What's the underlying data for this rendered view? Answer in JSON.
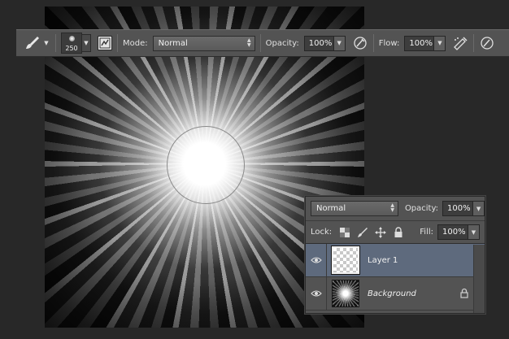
{
  "options_bar": {
    "brush_size": "250",
    "mode_label": "Mode:",
    "mode_value": "Normal",
    "opacity_label": "Opacity:",
    "opacity_value": "100%",
    "flow_label": "Flow:",
    "flow_value": "100%",
    "icons": [
      "brush-tool-icon",
      "dropdown-arrow-icon",
      "brush-preset-icon",
      "brush-panel-toggle-icon",
      "pressure-opacity-icon",
      "airbrush-icon",
      "pressure-size-icon"
    ]
  },
  "layers_panel": {
    "blend_mode": "Normal",
    "opacity_label": "Opacity:",
    "opacity_value": "100%",
    "lock_label": "Lock:",
    "fill_label": "Fill:",
    "fill_value": "100%",
    "layers": [
      {
        "name": "Layer 1",
        "selected": true,
        "visible": true,
        "locked": false
      },
      {
        "name": "Background",
        "selected": false,
        "visible": true,
        "locked": true
      }
    ]
  },
  "colors": {
    "ui_background": "#282828",
    "panel": "#535353",
    "selected_layer": "#5e6a7d"
  }
}
